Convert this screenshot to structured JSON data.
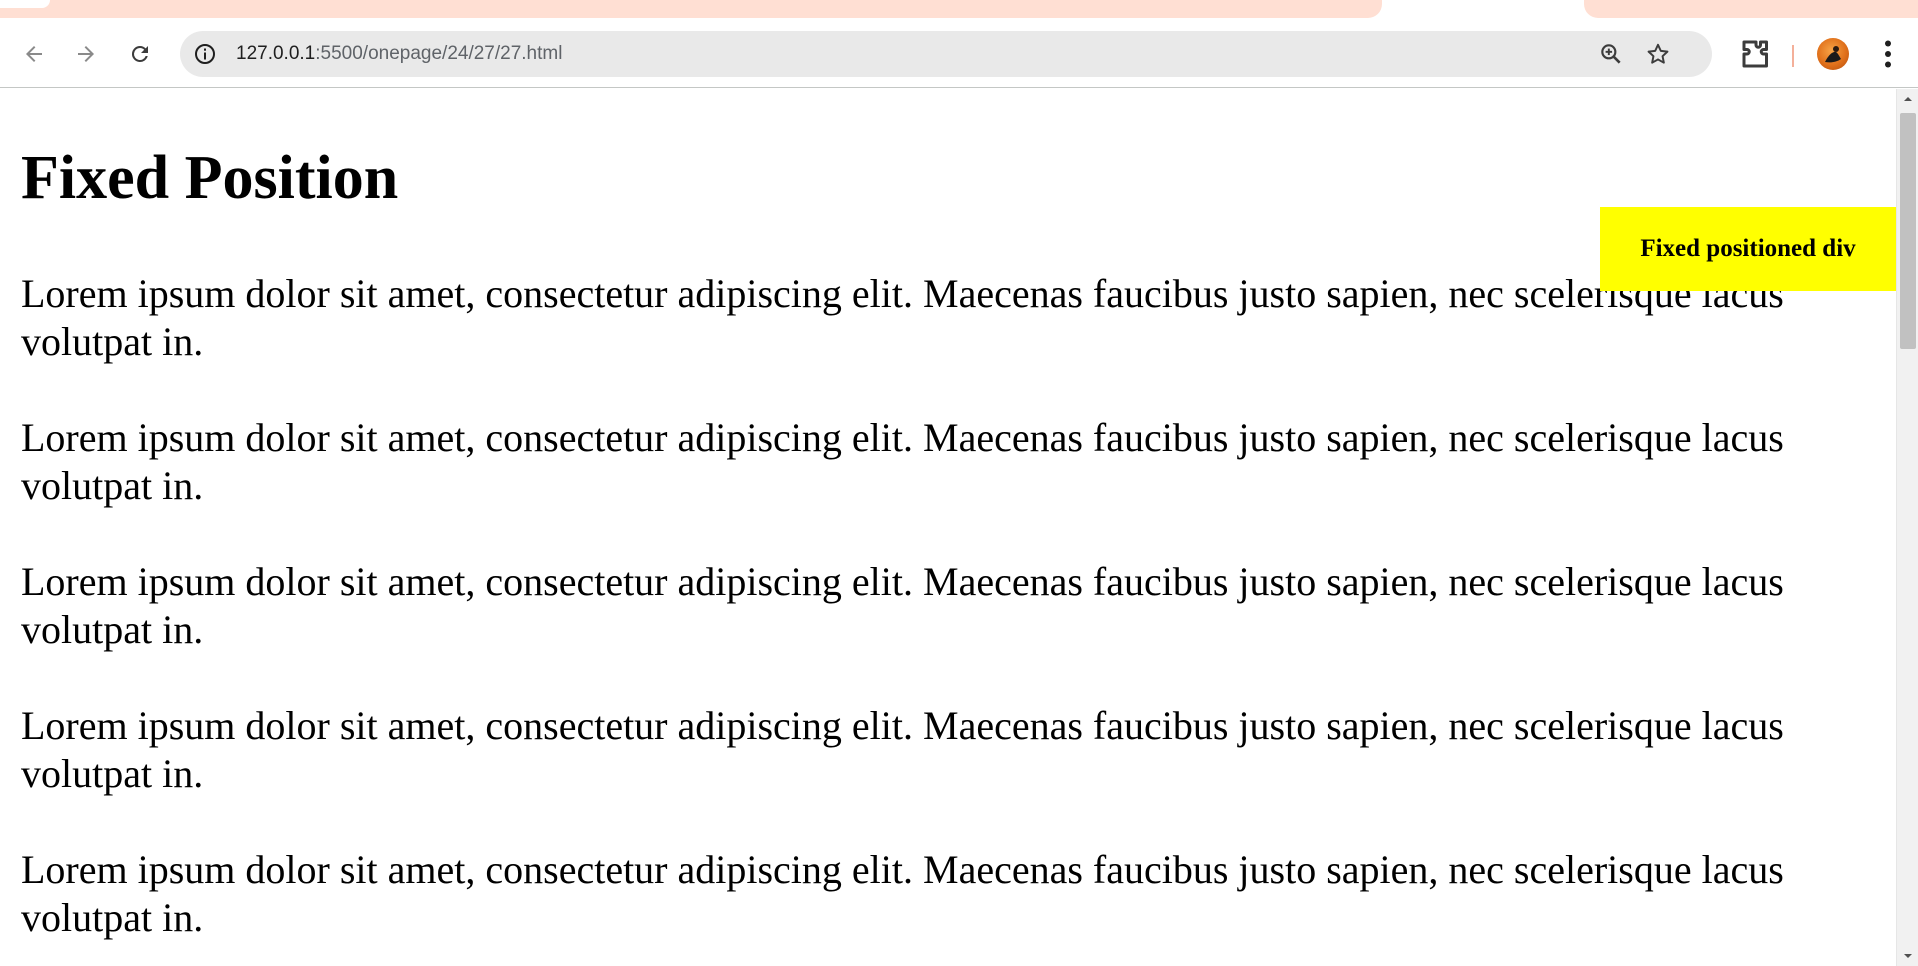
{
  "browser": {
    "url_host": "127.0.0.1",
    "url_path": ":5500/onepage/24/27/27.html",
    "icons": {
      "back": "back-arrow-icon",
      "forward": "forward-arrow-icon",
      "reload": "reload-icon",
      "site_info": "site-info-icon",
      "zoom": "zoom-icon",
      "bookmark": "star-icon",
      "extensions": "puzzle-icon",
      "profile": "avatar",
      "menu": "kebab-menu-icon"
    },
    "colors": {
      "tab_strip": "#ffdfd3",
      "omnibox": "#e9e9e9"
    }
  },
  "page": {
    "heading": "Fixed Position",
    "fixed_div_label": "Fixed positioned div",
    "fixed_div_color": "#ffff00",
    "paragraphs": [
      "Lorem ipsum dolor sit amet, consectetur adipiscing elit. Maecenas faucibus justo sapien, nec scelerisque lacus volutpat in.",
      "Lorem ipsum dolor sit amet, consectetur adipiscing elit. Maecenas faucibus justo sapien, nec scelerisque lacus volutpat in.",
      "Lorem ipsum dolor sit amet, consectetur adipiscing elit. Maecenas faucibus justo sapien, nec scelerisque lacus volutpat in.",
      "Lorem ipsum dolor sit amet, consectetur adipiscing elit. Maecenas faucibus justo sapien, nec scelerisque lacus volutpat in.",
      "Lorem ipsum dolor sit amet, consectetur adipiscing elit. Maecenas faucibus justo sapien, nec scelerisque lacus volutpat in."
    ]
  }
}
